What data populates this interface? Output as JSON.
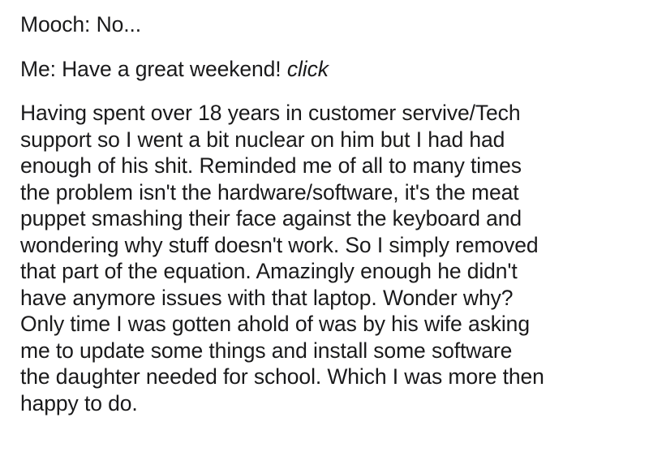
{
  "post": {
    "line1": "Mooch: No...",
    "line2_prefix": "Me: Have a great weekend! ",
    "line2_italic": "click",
    "body_lines": [
      "Having spent over 18 years in customer servive/Tech",
      "support so I went a bit nuclear on him but I had had",
      "enough of his shit. Reminded me of all to many times",
      "the problem isn't the hardware/software, it's the meat",
      "puppet smashing their face against the keyboard and",
      "wondering why stuff doesn't work. So I simply removed",
      "that part of the equation. Amazingly enough he didn't",
      "have anymore issues with that laptop. Wonder why?",
      "Only time I was gotten ahold of was by his wife asking",
      "me to update some things and install some software",
      "the daughter needed for school. Which I was more then",
      "happy to do."
    ]
  }
}
